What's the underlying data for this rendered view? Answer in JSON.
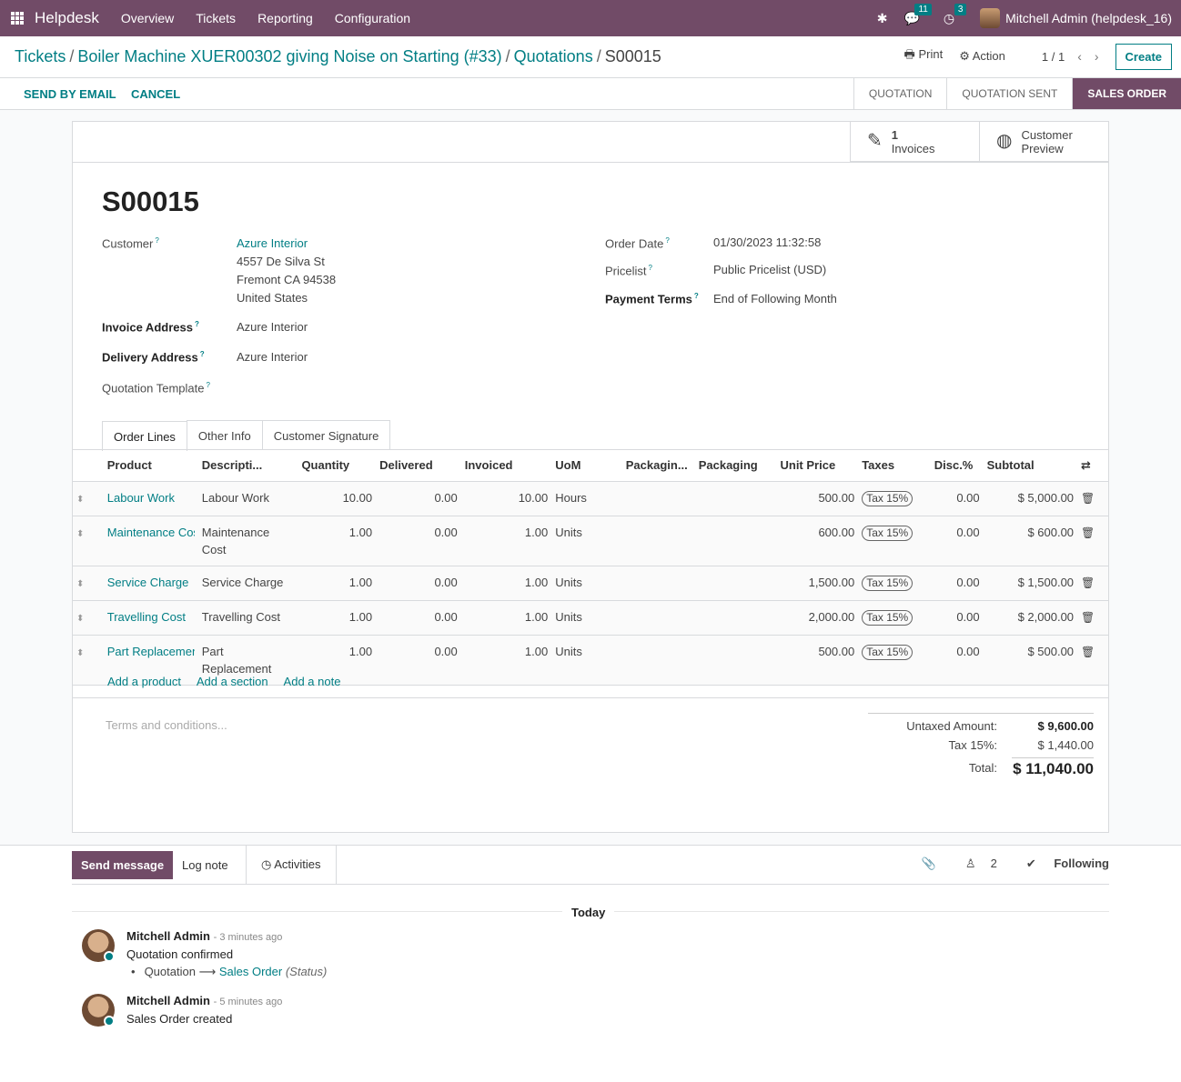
{
  "navbar": {
    "brand": "Helpdesk",
    "menu": [
      "Overview",
      "Tickets",
      "Reporting",
      "Configuration"
    ],
    "messages_count": "11",
    "activities_count": "3",
    "user": "Mitchell Admin (helpdesk_16)"
  },
  "breadcrumb": {
    "items": [
      "Tickets",
      "Boiler Machine XUER00302 giving Noise on Starting (#33)",
      "Quotations"
    ],
    "current": "S00015"
  },
  "control": {
    "print": "Print",
    "action": "Action",
    "pager": "1 / 1",
    "create": "Create"
  },
  "statusbar": {
    "send_email": "SEND BY EMAIL",
    "cancel": "CANCEL",
    "stages": [
      "QUOTATION",
      "QUOTATION SENT",
      "SALES ORDER"
    ],
    "active_stage": "SALES ORDER"
  },
  "smart_buttons": {
    "invoices_count": "1",
    "invoices_label": "Invoices",
    "preview_line1": "Customer",
    "preview_line2": "Preview"
  },
  "form": {
    "title": "S00015",
    "customer_label": "Customer",
    "customer_name": "Azure Interior",
    "customer_addr1": "4557 De Silva St",
    "customer_addr2": "Fremont CA 94538",
    "customer_addr3": "United States",
    "invoice_label": "Invoice Address",
    "invoice_value": "Azure Interior",
    "delivery_label": "Delivery Address",
    "delivery_value": "Azure Interior",
    "template_label": "Quotation Template",
    "order_date_label": "Order Date",
    "order_date": "01/30/2023 11:32:58",
    "pricelist_label": "Pricelist",
    "pricelist": "Public Pricelist (USD)",
    "payment_label": "Payment Terms",
    "payment": "End of Following Month"
  },
  "tabs": [
    "Order Lines",
    "Other Info",
    "Customer Signature"
  ],
  "lines": {
    "headers": [
      "Product",
      "Descripti...",
      "Quantity",
      "Delivered",
      "Invoiced",
      "UoM",
      "Packagin...",
      "Packaging",
      "Unit Price",
      "Taxes",
      "Disc.%",
      "Subtotal"
    ],
    "rows": [
      {
        "product": "Labour Work",
        "desc": "Labour Work",
        "qty": "10.00",
        "delivered": "0.00",
        "invoiced": "10.00",
        "uom": "Hours",
        "price": "500.00",
        "tax": "Tax 15%",
        "disc": "0.00",
        "subtotal": "$ 5,000.00"
      },
      {
        "product": "Maintenance Cost",
        "desc": "Maintenance Cost",
        "qty": "1.00",
        "delivered": "0.00",
        "invoiced": "1.00",
        "uom": "Units",
        "price": "600.00",
        "tax": "Tax 15%",
        "disc": "0.00",
        "subtotal": "$ 600.00"
      },
      {
        "product": "Service Charge",
        "desc": "Service Charge",
        "qty": "1.00",
        "delivered": "0.00",
        "invoiced": "1.00",
        "uom": "Units",
        "price": "1,500.00",
        "tax": "Tax 15%",
        "disc": "0.00",
        "subtotal": "$ 1,500.00"
      },
      {
        "product": "Travelling Cost",
        "desc": "Travelling Cost",
        "qty": "1.00",
        "delivered": "0.00",
        "invoiced": "1.00",
        "uom": "Units",
        "price": "2,000.00",
        "tax": "Tax 15%",
        "disc": "0.00",
        "subtotal": "$ 2,000.00"
      },
      {
        "product": "Part Replacement",
        "desc": "Part Replacement",
        "qty": "1.00",
        "delivered": "0.00",
        "invoiced": "1.00",
        "uom": "Units",
        "price": "500.00",
        "tax": "Tax 15%",
        "disc": "0.00",
        "subtotal": "$ 500.00"
      }
    ],
    "add_product": "Add a product",
    "add_section": "Add a section",
    "add_note": "Add a note"
  },
  "terms_placeholder": "Terms and conditions...",
  "totals": {
    "untaxed_label": "Untaxed Amount:",
    "untaxed": "$ 9,600.00",
    "tax_label": "Tax 15%:",
    "tax": "$ 1,440.00",
    "total_label": "Total:",
    "total": "$ 11,040.00"
  },
  "chatter": {
    "send_message": "Send message",
    "log_note": "Log note",
    "activities": "Activities",
    "followers": "2",
    "following": "Following",
    "today": "Today",
    "messages": [
      {
        "author": "Mitchell Admin",
        "time": "- 3 minutes ago",
        "body": "Quotation confirmed",
        "old": "Quotation",
        "new": "Sales Order",
        "field": "(Status)"
      },
      {
        "author": "Mitchell Admin",
        "time": "- 5 minutes ago",
        "body": "Sales Order created"
      }
    ]
  }
}
